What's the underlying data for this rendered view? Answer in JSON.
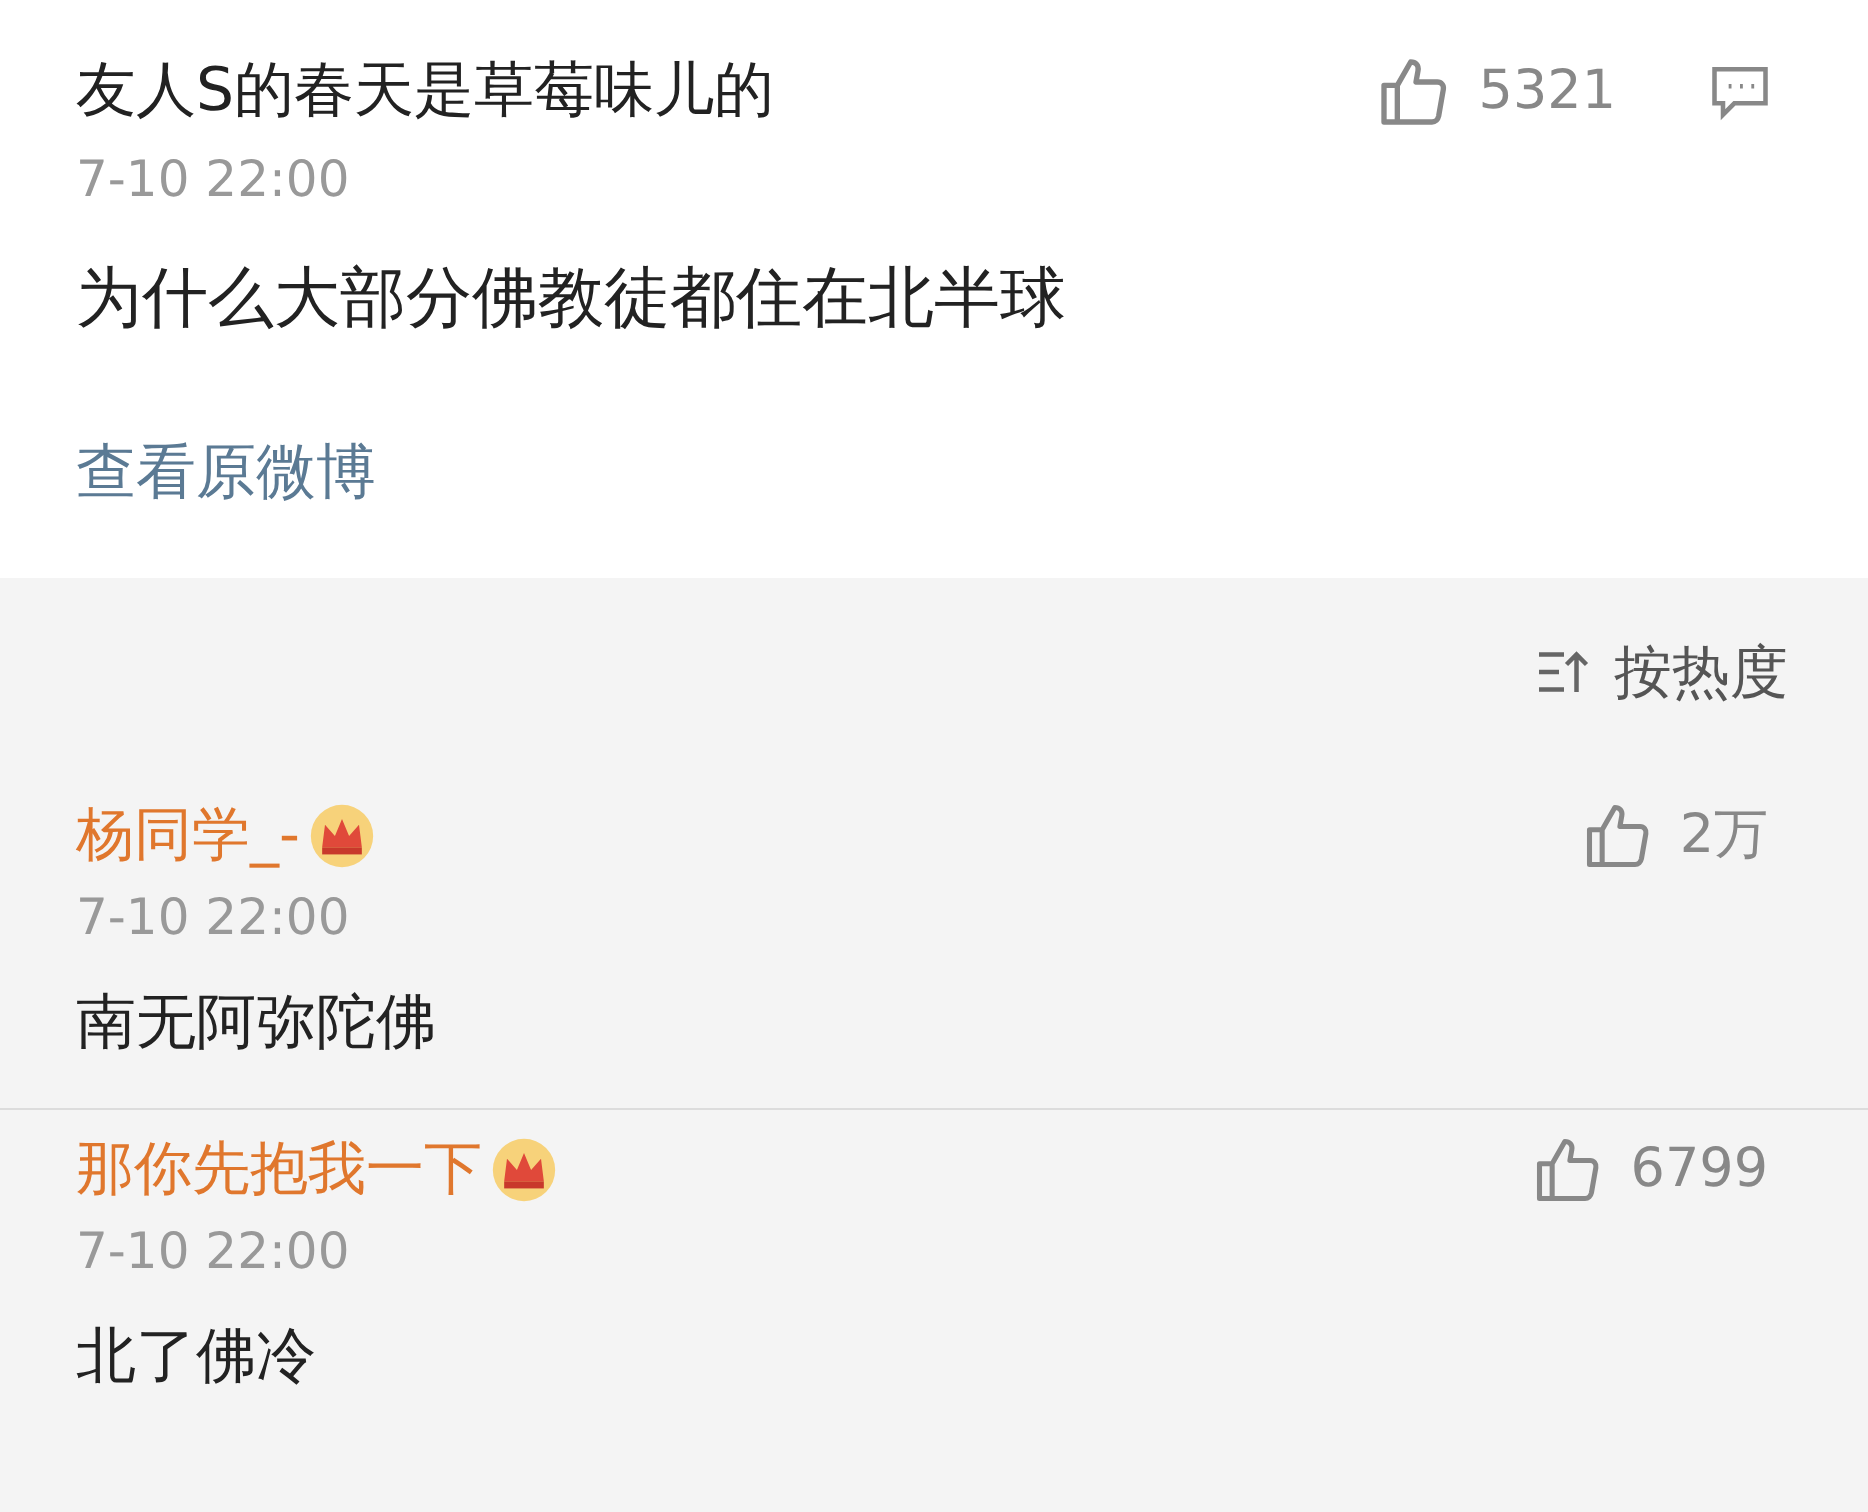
{
  "post": {
    "author": "友人S的春天是草莓味儿的",
    "time": "7-10 22:00",
    "text": "为什么大部分佛教徒都住在北半球",
    "likes": "5321",
    "link": "查看原微博"
  },
  "sort": {
    "label": "按热度"
  },
  "comments": [
    {
      "author": "杨同学_-",
      "time": "7-10 22:00",
      "text": "南无阿弥陀佛",
      "likes": "2万"
    },
    {
      "author": "那你先抱我一下",
      "time": "7-10 22:00",
      "text": "北了佛冷",
      "likes": "6799"
    }
  ]
}
